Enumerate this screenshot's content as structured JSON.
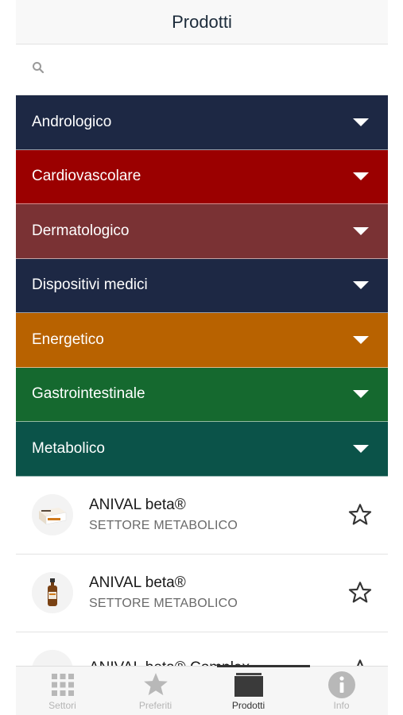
{
  "header": {
    "title": "Prodotti"
  },
  "search": {
    "placeholder": "",
    "value": ""
  },
  "categories": [
    {
      "label": "Andrologico",
      "color": "#1d2844"
    },
    {
      "label": "Cardiovascolare",
      "color": "#9b0000"
    },
    {
      "label": "Dermatologico",
      "color": "#7a3234"
    },
    {
      "label": "Dispositivi medici",
      "color": "#1d2844"
    },
    {
      "label": "Energetico",
      "color": "#b86200"
    },
    {
      "label": "Gastrointestinale",
      "color": "#15692f"
    },
    {
      "label": "Metabolico",
      "color": "#0b5349"
    }
  ],
  "products": [
    {
      "name": "ANIVAL beta®",
      "sector": "SETTORE METABOLICO",
      "icon": "box-product-thumbnail"
    },
    {
      "name": "ANIVAL beta®",
      "sector": "SETTORE METABOLICO",
      "icon": "bottle-product-thumbnail"
    },
    {
      "name": "ANIVAL beta® Complex",
      "sector": "",
      "icon": "product-thumbnail"
    }
  ],
  "tabbar": {
    "tabs": [
      {
        "label": "Settori",
        "icon": "grid-icon",
        "active": false
      },
      {
        "label": "Preferiti",
        "icon": "star-icon",
        "active": false
      },
      {
        "label": "Prodotti",
        "icon": "box-icon",
        "active": true
      },
      {
        "label": "Info",
        "icon": "info-icon",
        "active": false
      }
    ]
  }
}
